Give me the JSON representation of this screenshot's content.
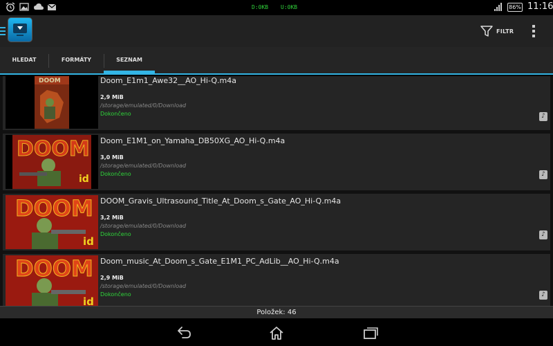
{
  "status_bar": {
    "download_speed": "D:0KB",
    "upload_speed": "U:0KB",
    "battery_percent": "86%",
    "battery_level": 0.86,
    "time": "11:16",
    "accent_color": "#2fcf3a"
  },
  "action_bar": {
    "app_icon": "tv-download-icon",
    "filter_label": "FILTR",
    "menu_icon": "overflow-menu-icon"
  },
  "tabs": [
    {
      "label": "HLEDAT",
      "selected": false
    },
    {
      "label": "FORMÁTY",
      "selected": false
    },
    {
      "label": "SEZNAM",
      "selected": true
    }
  ],
  "tab_accent": "#33b5e5",
  "items": [
    {
      "title": "Doom_E1m1_Awe32__AO_Hi-Q.m4a",
      "size": "2,9 MiB",
      "path": "/storage/emulated/0/Download",
      "status": "Dokončeno",
      "thumb": "doom-cover-small"
    },
    {
      "title": "Doom_E1M1_on_Yamaha_DB50XG_AO_Hi-Q.m4a",
      "size": "3,0 MiB",
      "path": "/storage/emulated/0/Download",
      "status": "Dokončeno",
      "thumb": "doom-cover"
    },
    {
      "title": "DOOM_Gravis_Ultrasound_Title_At_Doom_s_Gate_AO_Hi-Q.m4a",
      "size": "3,2 MiB",
      "path": "/storage/emulated/0/Download",
      "status": "Dokončeno",
      "thumb": "doom-cover"
    },
    {
      "title": "Doom_music_At_Doom_s_Gate_E1M1_PC_AdLib__AO_Hi-Q.m4a",
      "size": "2,9 MiB",
      "path": "/storage/emulated/0/Download",
      "status": "Dokončeno",
      "thumb": "doom-cover"
    }
  ],
  "footer": {
    "count_text": "Položek: 46"
  },
  "nav_bar": {
    "back_icon": "back-icon",
    "home_icon": "home-icon",
    "recents_icon": "recents-icon"
  }
}
